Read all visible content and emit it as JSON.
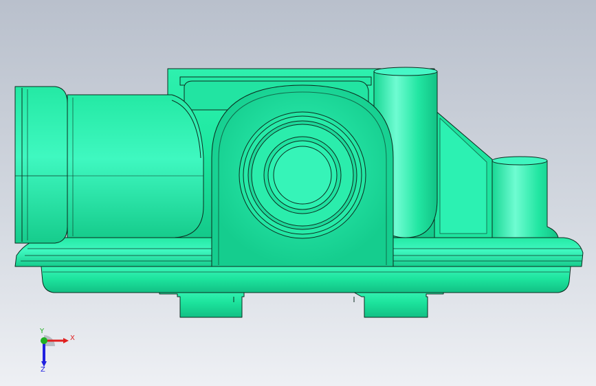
{
  "colors": {
    "part": "#1de8a0",
    "part_light": "#4ff7c4",
    "part_dark": "#10b97c",
    "edge": "#0c2a1e",
    "x_axis": "#e02020",
    "y_axis": "#20b020",
    "z_axis": "#2020e0"
  },
  "triad": {
    "x_label": "X",
    "y_label": "Y",
    "z_label": "Z"
  }
}
